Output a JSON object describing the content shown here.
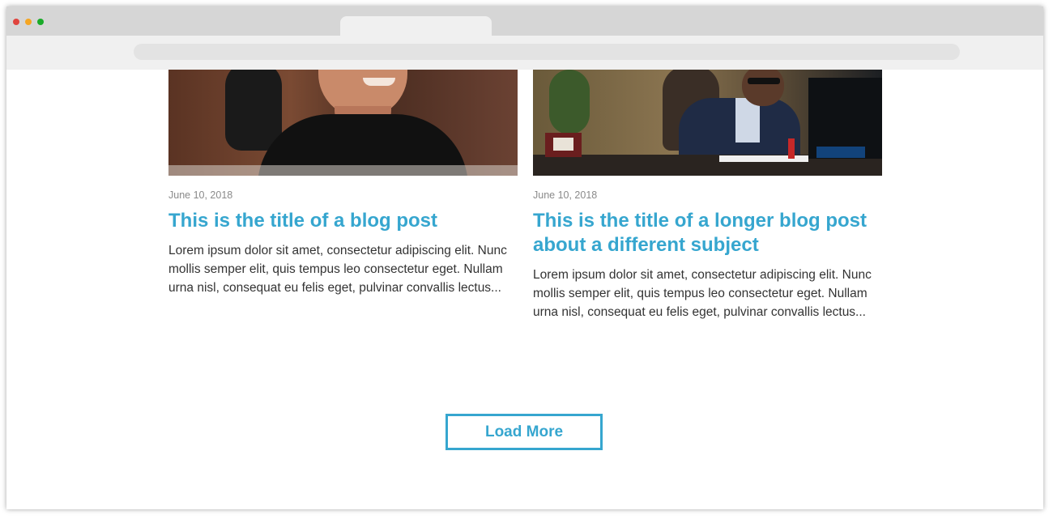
{
  "colors": {
    "accent": "#36a6cf",
    "body_text": "#333333",
    "date_text": "#8a8a8a",
    "window_close": "#e0443e",
    "window_minimize": "#f5a623",
    "window_zoom": "#1aab29"
  },
  "posts": [
    {
      "image": "photo-man-smiling-in-office-chair",
      "date": "June 10, 2018",
      "title": "This is the title of a blog post",
      "excerpt": "Lorem ipsum dolor sit amet, consectetur adipiscing elit. Nunc mollis semper elit, quis tempus leo consectetur eget. Nullam urna nisl, consequat eu felis eget, pulvinar convallis lectus..."
    },
    {
      "image": "photo-businessman-on-phone-at-desk",
      "date": "June 10, 2018",
      "title": "This is the title of a longer blog post about a different subject",
      "excerpt": "Lorem ipsum dolor sit amet, consectetur adipiscing elit. Nunc mollis semper elit, quis tempus leo consectetur eget. Nullam urna nisl, consequat eu felis eget, pulvinar convallis lectus..."
    }
  ],
  "load_more_label": "Load More"
}
